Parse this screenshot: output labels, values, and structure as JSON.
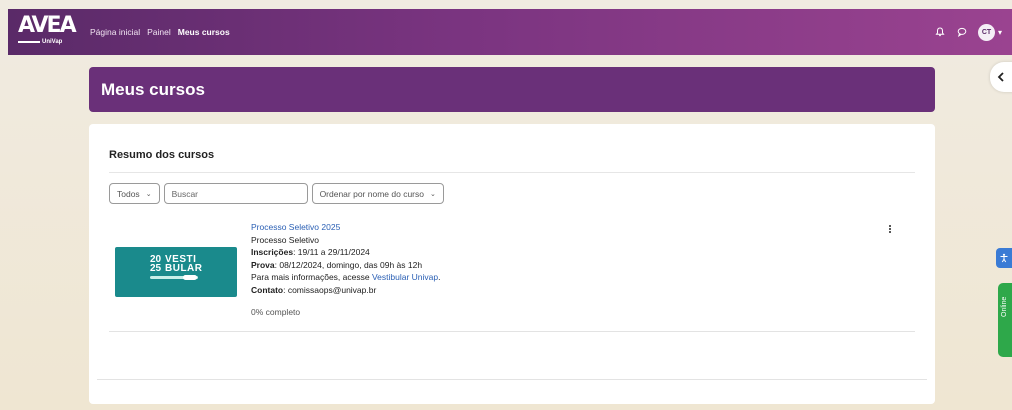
{
  "navbar": {
    "logo_text": "AVEA",
    "logo_sub": "UniVap",
    "links": [
      "Página inicial",
      "Painel",
      "Meus cursos"
    ],
    "active_link": "Meus cursos",
    "user_initials": "CT"
  },
  "page": {
    "title": "Meus cursos"
  },
  "summary": {
    "title": "Resumo dos cursos",
    "filter_label": "Todos",
    "search_placeholder": "Buscar",
    "sort_label": "Ordenar por nome do curso"
  },
  "courses": [
    {
      "name": "Processo Seletivo 2025",
      "category": "Processo Seletivo",
      "enrollment_label": "Inscrições",
      "enrollment_value": ": 19/11 a 29/11/2024",
      "exam_label": "Prova",
      "exam_value": ": 08/12/2024, domingo, das 09h às 12h",
      "info_text": "Para mais informações, acesse ",
      "info_link": "Vestibular Univap",
      "info_end": ".",
      "contact_label": "Contato",
      "contact_value": ": comissaops@univap.br",
      "progress_text": "0% completo",
      "progress_percent": 0,
      "thumbnail": {
        "year_top": "20",
        "year_bottom": "25",
        "word_top": "VESTI",
        "word_bottom": "BULAR",
        "background": "#1a8a8c"
      }
    }
  ],
  "widgets": {
    "online_label": "Online"
  },
  "colors": {
    "navbar_start": "#5a2a68",
    "navbar_end": "#9a4390",
    "header": "#6a3079",
    "link": "#2a5fb4",
    "online": "#2ea84a",
    "accessibility": "#3a7bd5"
  }
}
